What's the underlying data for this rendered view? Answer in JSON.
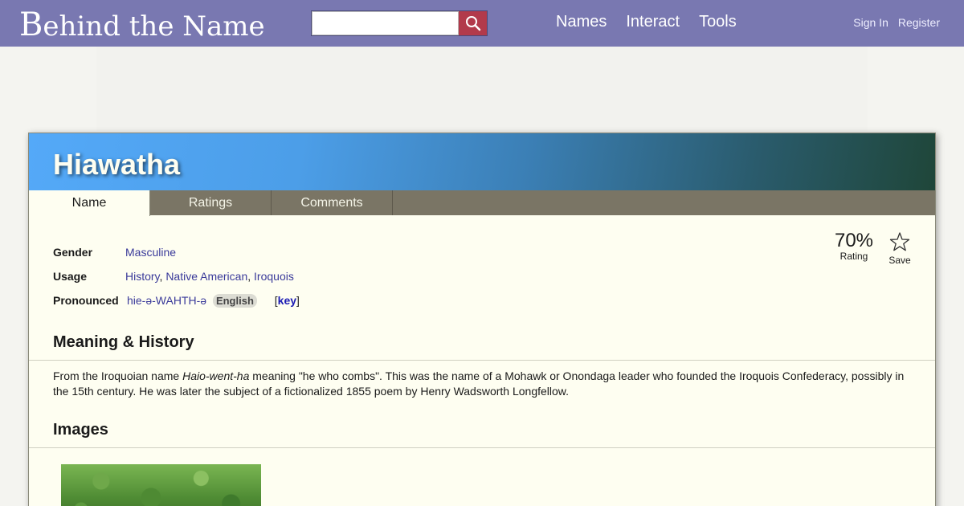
{
  "header": {
    "logo_first": "B",
    "logo_rest": "ehind the Name",
    "search": {
      "value": "",
      "placeholder": ""
    },
    "nav": [
      "Names",
      "Interact",
      "Tools"
    ],
    "account": {
      "sign_in": "Sign In",
      "register": "Register"
    }
  },
  "name_card": {
    "title": "Hiawatha",
    "tabs": [
      {
        "label": "Name",
        "active": true
      },
      {
        "label": "Ratings",
        "active": false
      },
      {
        "label": "Comments",
        "active": false
      }
    ],
    "rating": {
      "value": "70%",
      "label": "Rating"
    },
    "save_label": "Save",
    "info": {
      "gender_label": "Gender",
      "gender_value": "Masculine",
      "usage_label": "Usage",
      "usage_values": [
        "History",
        "Native American",
        "Iroquois"
      ],
      "pronounced_label": "Pronounced",
      "pronunciation": "hie-ə-WAHTH-ə",
      "pronunciation_lang": "English",
      "key_label": "key"
    },
    "meaning": {
      "heading": "Meaning & History",
      "text_before": "From the Iroquoian name ",
      "text_italic": "Haio-went-ha",
      "text_after": " meaning \"he who combs\". This was the name of a Mohawk or Onondaga leader who founded the Iroquois Confederacy, possibly in the 15th century. He was later the subject of a fictionalized 1855 poem by Henry Wadsworth Longfellow."
    },
    "images": {
      "heading": "Images"
    }
  },
  "colors": {
    "topbar": "#7978b1",
    "card_background": "#fefef1",
    "tab_bar": "#7a7565",
    "search_button": "#b23a4b",
    "link": "#3a3a9a"
  }
}
